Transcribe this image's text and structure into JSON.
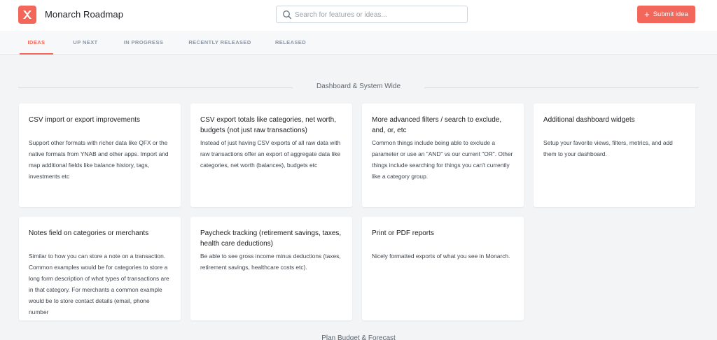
{
  "header": {
    "app_title": "Monarch Roadmap",
    "search_placeholder": "Search for features or ideas...",
    "submit_label": "Submit idea",
    "brand_color": "#f2675a"
  },
  "tabs": [
    {
      "label": "IDEAS",
      "active": true
    },
    {
      "label": "UP NEXT",
      "active": false
    },
    {
      "label": "IN PROGRESS",
      "active": false
    },
    {
      "label": "RECENTLY RELEASED",
      "active": false
    },
    {
      "label": "RELEASED",
      "active": false
    }
  ],
  "sections": [
    {
      "title": "Dashboard & System Wide",
      "cards": [
        {
          "title": "CSV import or export improvements",
          "description": "Support other formats with richer data like QFX or the native formats from YNAB and other apps. Import and map additional fields like balance history, tags, investments etc"
        },
        {
          "title": "CSV export totals like categories, net worth, budgets (not just raw transactions)",
          "description": "Instead of just having CSV exports of all raw data with raw transactions offer an export of aggregate data like categories, net worth (balances), budgets etc"
        },
        {
          "title": "More advanced filters / search to exclude, and, or, etc",
          "description": "Common things include being able to exclude a parameter or use an \"AND\" vs our current \"OR\". Other things include searching for things you can't currently like a category group."
        },
        {
          "title": "Additional dashboard widgets",
          "description": "Setup your favorite views, filters, metrics, and add them to your dashboard."
        },
        {
          "title": "Notes field on categories or merchants",
          "description": "Similar to how you can store a note on a transaction. Common examples would be for categories to store a long form description of what types of transactions are in that category. For merchants a common example would be to store contact details (email, phone number"
        },
        {
          "title": "Paycheck tracking (retirement savings, taxes, health care deductions)",
          "description": "Be able to see gross income minus deductions (taxes, retirement savings, healthcare costs etc)."
        },
        {
          "title": "Print or PDF reports",
          "description": "Nicely formatted exports of what you see in Monarch."
        }
      ]
    },
    {
      "title": "Plan Budget & Forecast",
      "cards": []
    }
  ]
}
